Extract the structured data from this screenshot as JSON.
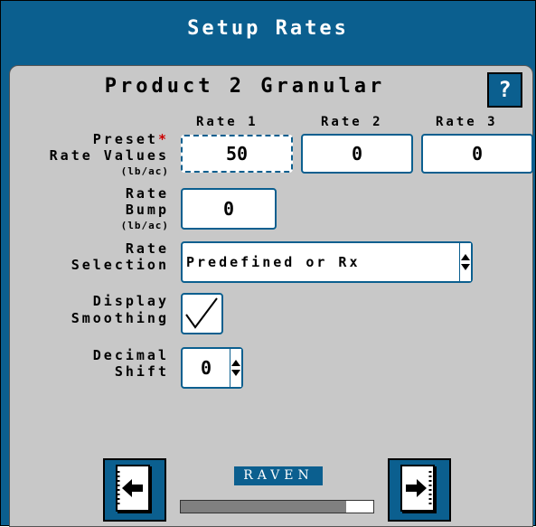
{
  "header": {
    "title": "Setup Rates"
  },
  "panel": {
    "product_name": "Product 2 Granular",
    "help_label": "?",
    "columns": [
      "Rate 1",
      "Rate 2",
      "Rate 3"
    ],
    "preset": {
      "label_line1": "Preset",
      "required_mark": "*",
      "label_line2": "Rate Values",
      "unit": "(lb/ac)",
      "values": [
        "50",
        "0",
        "0"
      ]
    },
    "bump": {
      "label_line1": "Rate",
      "label_line2": "Bump",
      "unit": "(lb/ac)",
      "value": "0"
    },
    "selection": {
      "label_line1": "Rate",
      "label_line2": "Selection",
      "value": "Predefined or Rx"
    },
    "smoothing": {
      "label_line1": "Display",
      "label_line2": "Smoothing",
      "checked": true
    },
    "decimal": {
      "label_line1": "Decimal",
      "label_line2": "Shift",
      "value": "0"
    }
  },
  "footer": {
    "logo_text": "RAVEN",
    "progress": 0.86,
    "back_icon": "back-page-icon",
    "next_icon": "next-page-icon"
  },
  "colors": {
    "brand": "#0b5f8f",
    "panel": "#c8c8c8",
    "required": "#cc0000"
  }
}
